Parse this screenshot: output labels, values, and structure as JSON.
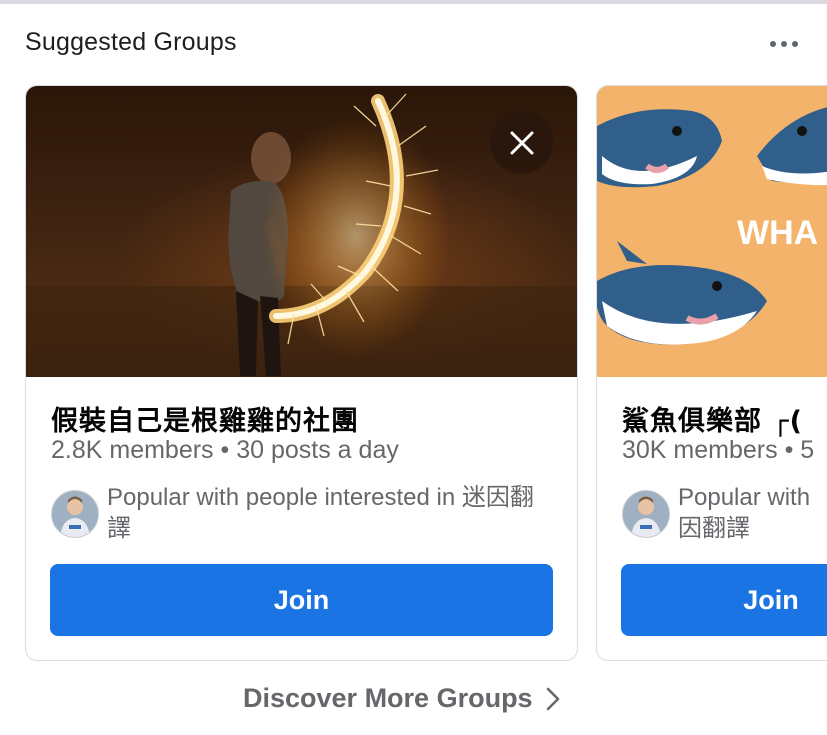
{
  "section": {
    "title": "Suggested Groups",
    "more_label": "More options"
  },
  "cards": [
    {
      "name": "假裝自己是根雞雞的社團",
      "members": "2.8K members",
      "separator": "•",
      "activity": "30 posts a day",
      "popular": "Popular with people interested in 迷因翻譯",
      "join_label": "Join"
    },
    {
      "name": "鯊魚俱樂部 ┌(",
      "members": "30K members",
      "separator": "•",
      "activity": "5",
      "popular": "Popular with",
      "popular_line2": "因翻譯",
      "image_text": "WHA",
      "join_label": "Join"
    }
  ],
  "footer": {
    "discover_label": "Discover More Groups"
  },
  "colors": {
    "primary": "#1b74e4",
    "secondary_text": "#65676b",
    "border": "#dadde1"
  }
}
